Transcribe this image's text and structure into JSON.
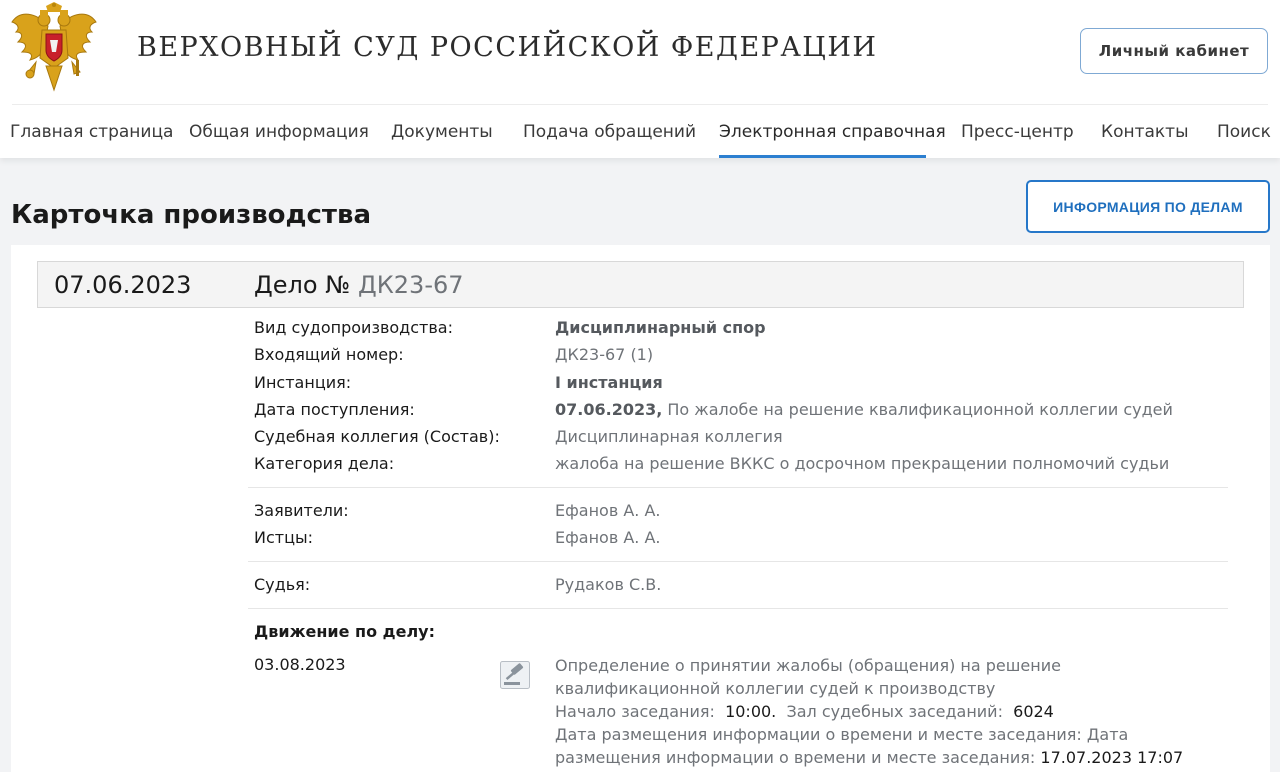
{
  "header": {
    "site_title": "ВЕРХОВНЫЙ СУД РОССИЙСКОЙ ФЕДЕРАЦИИ",
    "cabinet_label": "Личный кабинет",
    "emblem_icon": "double-headed-eagle-emblem"
  },
  "nav": {
    "items": [
      {
        "label": "Главная страница"
      },
      {
        "label": "Общая информация"
      },
      {
        "label": "Документы"
      },
      {
        "label": "Подача обращений"
      },
      {
        "label": "Электронная справочная"
      },
      {
        "label": "Пресс-центр"
      },
      {
        "label": "Контакты"
      },
      {
        "label": "Поиск"
      }
    ],
    "active": "Электронная справочная"
  },
  "page": {
    "title": "Карточка производства",
    "cases_button": "ИНФОРМАЦИЯ ПО ДЕЛАМ"
  },
  "case": {
    "date": "07.06.2023",
    "number_label": "Дело №",
    "number": "ДК23-67",
    "fields": {
      "proceeding_type_label": "Вид судопроизводства:",
      "proceeding_type": "Дисциплинарный спор",
      "incoming_number_label": "Входящий номер:",
      "incoming_number": "ДК23-67 (1)",
      "instance_label": "Инстанция:",
      "instance": "I инстанция",
      "receipt_date_label": "Дата поступления:",
      "receipt_date": "07.06.2023,",
      "receipt_note": "По жалобе на решение квалификационной коллегии судей",
      "collegium_label": "Судебная коллегия (Состав):",
      "collegium": "Дисциплинарная коллегия",
      "category_label": "Категория дела:",
      "category": "жалоба на решение ВККС о досрочном прекращении полномочий судьи"
    },
    "parties": {
      "applicants_label": "Заявители:",
      "applicants": "Ефанов А. А.",
      "plaintiffs_label": "Истцы:",
      "plaintiffs": "Ефанов А. А."
    },
    "judge": {
      "label": "Судья:",
      "name": "Рудаков С.В."
    },
    "movement": {
      "title": "Движение по делу:",
      "entries": [
        {
          "date": "03.08.2023",
          "icon": "gavel-icon",
          "text": "Определение о принятии жалобы (обращения) на решение квалификационной коллегии судей к производству",
          "start_label": "Начало заседания:",
          "start_time": "10:00.",
          "hall_label": "Зал судебных заседаний:",
          "hall": "6024",
          "posted_label": "Дата размещения информации о времени и месте заседания: Дата размещения информации о времени и месте заседания:",
          "posted_value": "17.07.2023 17:07"
        }
      ]
    }
  }
}
